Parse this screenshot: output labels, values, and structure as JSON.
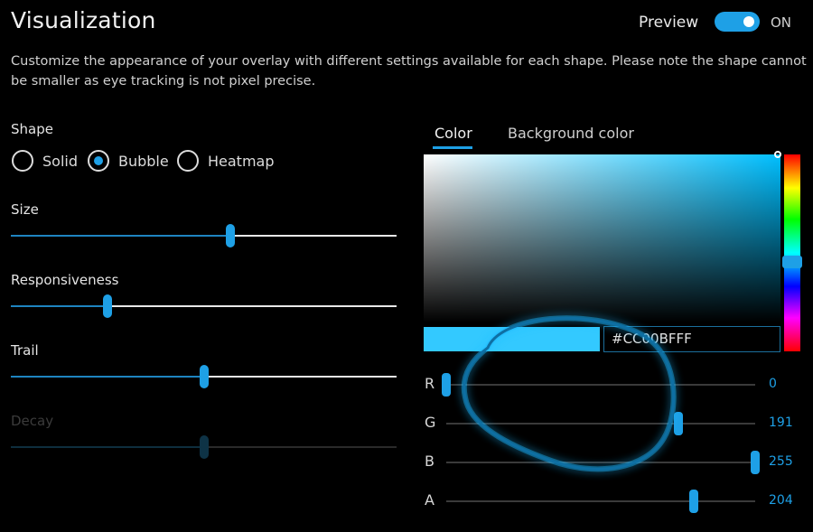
{
  "header": {
    "title": "Visualization",
    "description": "Customize the appearance of your overlay with different settings available for each shape. Please note the shape cannot be smaller as eye tracking is not pixel precise.",
    "preview_label": "Preview",
    "preview_state": "ON",
    "preview_on": true
  },
  "shape": {
    "label": "Shape",
    "options": [
      {
        "label": "Solid",
        "checked": false
      },
      {
        "label": "Bubble",
        "checked": true
      },
      {
        "label": "Heatmap",
        "checked": false
      }
    ]
  },
  "sliders": {
    "size": {
      "label": "Size",
      "value": 0.57
    },
    "responsiveness": {
      "label": "Responsiveness",
      "value": 0.25
    },
    "trail": {
      "label": "Trail",
      "value": 0.5
    },
    "decay": {
      "label": "Decay",
      "value": 0.5,
      "disabled": true
    }
  },
  "color_panel": {
    "tabs": [
      "Color",
      "Background color"
    ],
    "active_tab": "Color",
    "hex_value": "#CC00BFFF",
    "swatch_color": "#33c9ff",
    "accent_color": "#1ea0e6",
    "channels": [
      {
        "label": "R",
        "value": "0",
        "fraction": 0.0
      },
      {
        "label": "G",
        "value": "191",
        "fraction": 0.75
      },
      {
        "label": "B",
        "value": "255",
        "fraction": 1.0
      },
      {
        "label": "A",
        "value": "204",
        "fraction": 0.8
      }
    ]
  }
}
